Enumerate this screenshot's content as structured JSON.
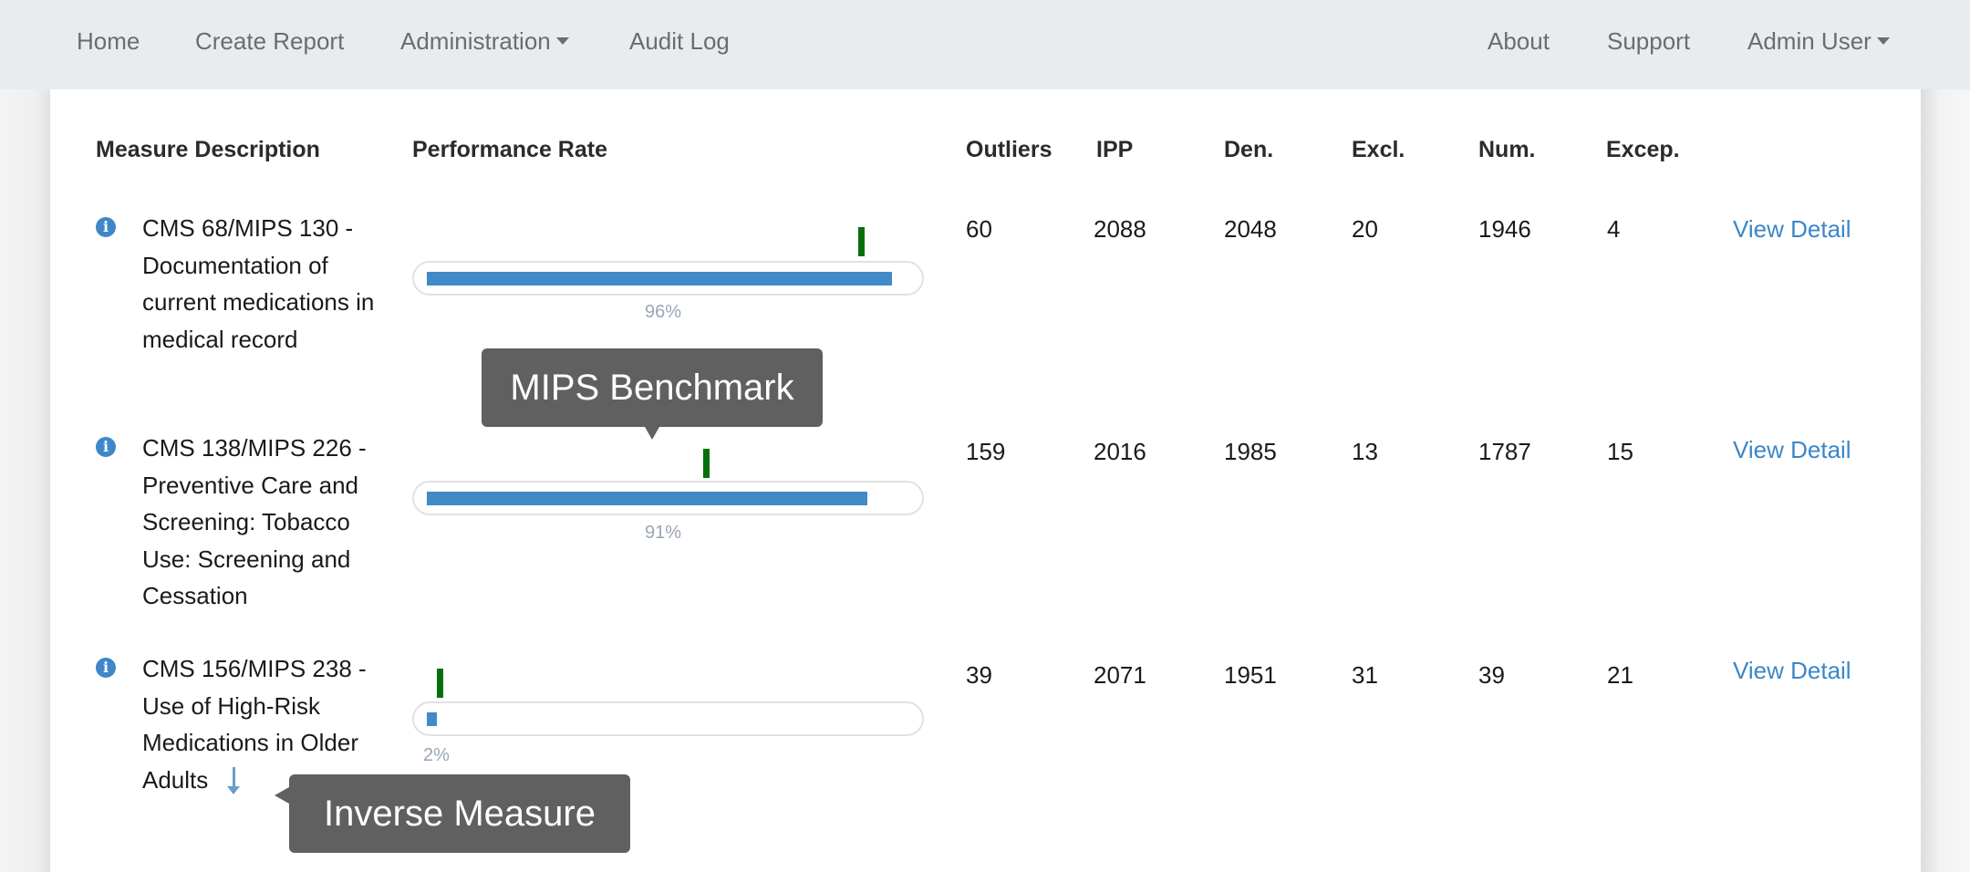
{
  "nav": {
    "left": [
      {
        "label": "Home"
      },
      {
        "label": "Create Report"
      },
      {
        "label": "Administration",
        "dropdown": true
      },
      {
        "label": "Audit Log"
      }
    ],
    "right": [
      {
        "label": "About"
      },
      {
        "label": "Support"
      },
      {
        "label": "Admin User",
        "dropdown": true
      }
    ]
  },
  "table": {
    "headers": {
      "description": "Measure Description",
      "performance": "Performance Rate",
      "outliers": "Outliers",
      "ipp": "IPP",
      "den": "Den.",
      "excl": "Excl.",
      "num": "Num.",
      "excep": "Excep."
    },
    "rows": [
      {
        "icon": "info-icon",
        "description": "CMS 68/MIPS 130 - Documentation of current medications in medical record",
        "performance_rate": 96,
        "performance_label": "96%",
        "benchmark": 90,
        "outliers": "60",
        "ipp": "2088",
        "den": "2048",
        "excl": "20",
        "num": "1946",
        "excep": "4",
        "link": "View Detail",
        "inverse": false
      },
      {
        "icon": "info-icon",
        "description": "CMS 138/MIPS 226 - Preventive Care and Screening: Tobacco Use: Screening and Cessation",
        "performance_rate": 91,
        "performance_label": "91%",
        "benchmark": 58,
        "outliers": "159",
        "ipp": "2016",
        "den": "1985",
        "excl": "13",
        "num": "1787",
        "excep": "15",
        "link": "View Detail",
        "inverse": false
      },
      {
        "icon": "info-icon",
        "description": "CMS 156/MIPS 238 - Use of High-Risk Medications in Older Adults",
        "performance_rate": 2,
        "performance_label": "2%",
        "benchmark": 3,
        "outliers": "39",
        "ipp": "2071",
        "den": "1951",
        "excl": "31",
        "num": "39",
        "excep": "21",
        "link": "View Detail",
        "inverse": true
      }
    ]
  },
  "tooltips": {
    "benchmark": "MIPS Benchmark",
    "inverse": "Inverse Measure"
  },
  "colors": {
    "bar": "#4289c8",
    "benchmark": "#05700b",
    "link": "#3a86c8",
    "tooltip_bg": "#606060",
    "nav_bg": "#e9ecef"
  }
}
